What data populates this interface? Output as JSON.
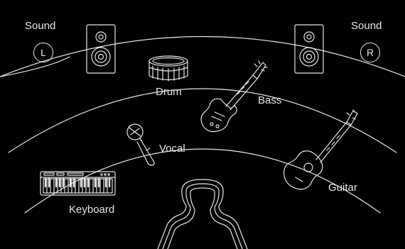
{
  "speakers": {
    "left": {
      "label": "Sound",
      "channel": "L"
    },
    "right": {
      "label": "Sound",
      "channel": "R"
    }
  },
  "instruments": {
    "drum": "Drum",
    "bass": "Bass",
    "vocal": "Vocal",
    "guitar": "Guitar",
    "keyboard": "Keyboard"
  },
  "colors": {
    "background": "#000000",
    "line": "#e6e6e6"
  }
}
